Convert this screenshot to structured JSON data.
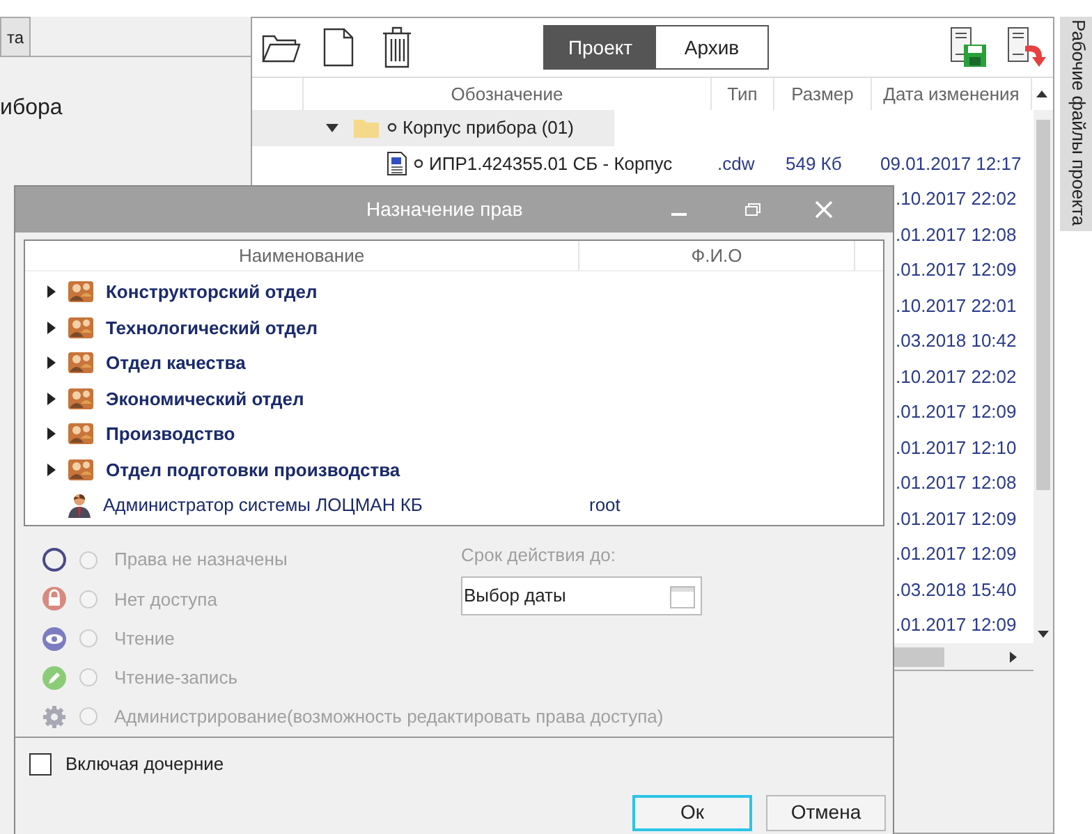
{
  "left_panel": {
    "tab": "та",
    "title": "ибора"
  },
  "files_panel": {
    "tabs": [
      {
        "label": "Проект",
        "selected": true
      },
      {
        "label": "Архив",
        "selected": false
      }
    ],
    "columns": [
      "Обозначение",
      "Тип",
      "Размер",
      "Дата изменения"
    ],
    "tree": [
      {
        "name": "Корпус прибора (01)",
        "expanded": true,
        "children": [
          {
            "name": "ИПР1.424355.01 СБ - Корпус",
            "type": ".cdw",
            "size": "549 Кб",
            "modified": "09.01.2017 12:17"
          }
        ]
      }
    ],
    "rows_behind_dialog": [
      {
        "modified": ".10.2017 22:02"
      },
      {
        "modified": ".01.2017 12:08"
      },
      {
        "modified": ".01.2017 12:09"
      },
      {
        "modified": ".10.2017 22:01"
      },
      {
        "modified": ".03.2018 10:42"
      },
      {
        "modified": ".10.2017 22:02"
      },
      {
        "modified": ".01.2017 12:09"
      },
      {
        "modified": ".01.2017 12:10"
      },
      {
        "modified": ".01.2017 12:08"
      },
      {
        "modified": ".01.2017 12:09"
      },
      {
        "modified": ".01.2017 12:09"
      },
      {
        "modified": ".03.2018 15:40"
      },
      {
        "modified": ".01.2017 12:09"
      }
    ]
  },
  "side_tab": "Рабочие файлы проекта",
  "dialog": {
    "title": "Назначение прав",
    "columns": [
      "Наименование",
      "Ф.И.О"
    ],
    "items": [
      {
        "kind": "group",
        "name": "Конструкторский отдел",
        "expanded": false
      },
      {
        "kind": "group",
        "name": "Технологический отдел",
        "expanded": false
      },
      {
        "kind": "group",
        "name": "Отдел качества",
        "expanded": false
      },
      {
        "kind": "group",
        "name": "Экономический отдел",
        "expanded": false
      },
      {
        "kind": "group",
        "name": "Производство",
        "expanded": false
      },
      {
        "kind": "group",
        "name": "Отдел подготовки производства",
        "expanded": false
      },
      {
        "kind": "user",
        "name": "Администратор системы ЛОЦМАН КБ",
        "login": "root"
      }
    ],
    "rights": [
      {
        "kind": "none",
        "label": "Права не назначены",
        "selected": false,
        "disabled": true
      },
      {
        "kind": "no_access",
        "label": "Нет доступа",
        "selected": false,
        "disabled": true
      },
      {
        "kind": "read",
        "label": "Чтение",
        "selected": false,
        "disabled": true
      },
      {
        "kind": "read_write",
        "label": "Чтение-запись",
        "selected": false,
        "disabled": true
      },
      {
        "kind": "admin",
        "label": "Администрирование(возможность редактировать права доступа)",
        "selected": false,
        "disabled": true
      }
    ],
    "expiry": {
      "label": "Срок действия до:",
      "value": "Выбор даты"
    },
    "include_children": {
      "label": "Включая дочерние",
      "checked": false
    },
    "buttons": [
      {
        "label": "Ок",
        "focused": true
      },
      {
        "label": "Отмена",
        "focused": false
      }
    ]
  }
}
